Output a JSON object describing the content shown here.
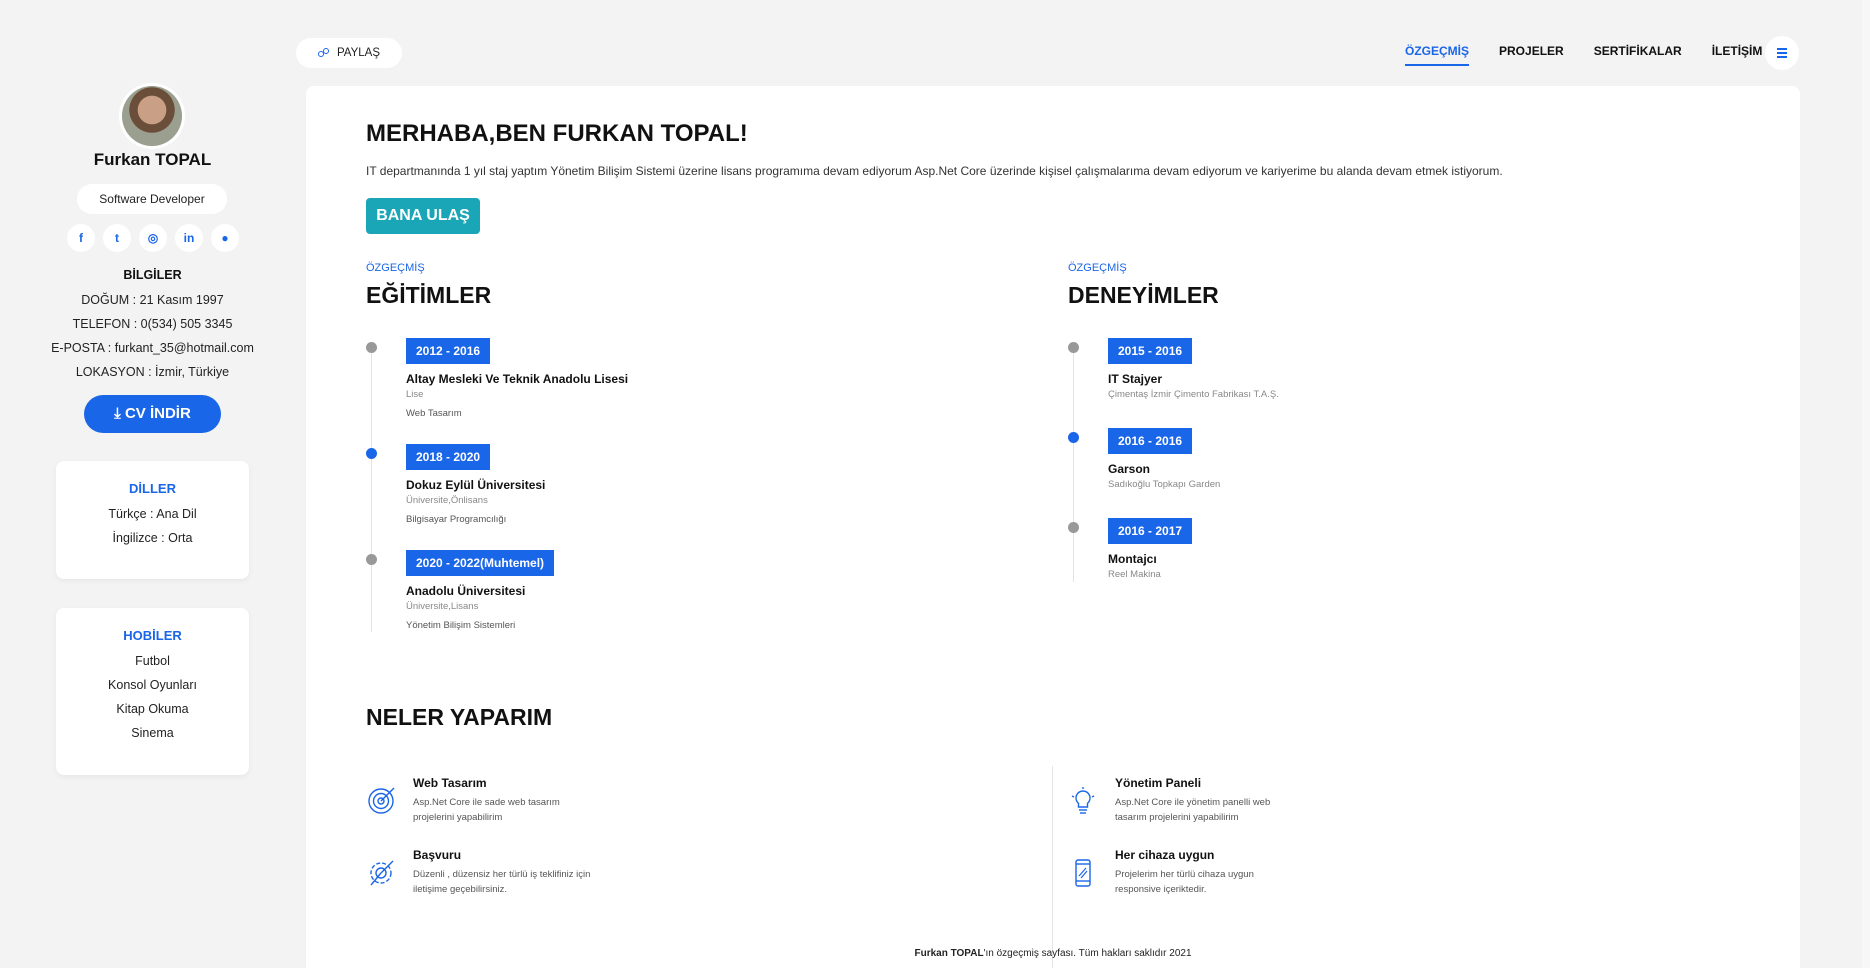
{
  "profile": {
    "name": "Furkan TOPAL",
    "role": "Software Developer",
    "socials": [
      {
        "icon": "facebook-icon",
        "glyph": "f"
      },
      {
        "icon": "twitter-icon",
        "glyph": "t"
      },
      {
        "icon": "instagram-icon",
        "glyph": "◎"
      },
      {
        "icon": "linkedin-icon",
        "glyph": "in"
      },
      {
        "icon": "github-icon",
        "glyph": "●"
      }
    ],
    "info_heading": "BİLGİLER",
    "birth": "DOĞUM : 21 Kasım 1997",
    "phone": "TELEFON : 0(534) 505 3345",
    "email": "E-POSTA : furkant_35@hotmail.com",
    "location": "LOKASYON : İzmir, Türkiye",
    "cv_button": "⤓ CV İNDİR"
  },
  "languages": {
    "title": "DİLLER",
    "items": [
      "Türkçe : Ana Dil",
      "İngilizce : Orta"
    ]
  },
  "hobbies": {
    "title": "HOBİLER",
    "items": [
      "Futbol",
      "Konsol Oyunları",
      "Kitap Okuma",
      "Sinema"
    ]
  },
  "topbar": {
    "share_label": "PAYLAŞ",
    "nav": [
      "ÖZGEÇMİŞ",
      "PROJELER",
      "SERTİFİKALAR",
      "İLETİŞİM"
    ],
    "active_nav": "ÖZGEÇMİŞ"
  },
  "hero": {
    "greeting": "MERHABA,BEN FURKAN TOPAL!",
    "intro": "IT departmanında 1 yıl staj yaptım Yönetim Bilişim Sistemi üzerine lisans programıma devam ediyorum Asp.Net Core üzerinde kişisel çalışmalarıma devam ediyorum ve kariyerime bu alanda devam etmek istiyorum.",
    "contact_button": "BANA ULAŞ"
  },
  "education": {
    "kicker": "ÖZGEÇMİŞ",
    "title": "EĞİTİMLER",
    "items": [
      {
        "years": "2012 - 2016",
        "school": "Altay Mesleki Ve Teknik Anadolu Lisesi",
        "type": "Lise",
        "field": "Web Tasarım",
        "active": false
      },
      {
        "years": "2018 - 2020",
        "school": "Dokuz Eylül Üniversitesi",
        "type": "Üniversite,Önlisans",
        "field": "Bilgisayar Programcılığı",
        "active": true
      },
      {
        "years": "2020 - 2022(Muhtemel)",
        "school": "Anadolu Üniversitesi",
        "type": "Üniversite,Lisans",
        "field": "Yönetim Bilişim Sistemleri",
        "active": false
      }
    ]
  },
  "experience": {
    "kicker": "ÖZGEÇMİŞ",
    "title": "DENEYİMLER",
    "items": [
      {
        "years": "2015 - 2016",
        "role": "IT Stajyer",
        "company": "Çimentaş İzmir Çimento Fabrikası T.A.Ş.",
        "active": false
      },
      {
        "years": "2016 - 2016",
        "role": "Garson",
        "company": "Sadıkoğlu Topkapı Garden",
        "active": true
      },
      {
        "years": "2016 - 2017",
        "role": "Montajcı",
        "company": "Reel Makina",
        "active": false
      }
    ]
  },
  "services": {
    "title": "NELER YAPARIM",
    "items": [
      {
        "icon": "target-icon",
        "title": "Web Tasarım",
        "desc": "Asp.Net Core ile sade web tasarım projelerini yapabilirim"
      },
      {
        "icon": "lightbulb-icon",
        "title": "Yönetim Paneli",
        "desc": "Asp.Net Core ile yönetim panelli web tasarım projelerini yapabilirim"
      },
      {
        "icon": "compass-gear-icon",
        "title": "Başvuru",
        "desc": "Düzenli , düzensiz her türlü iş teklifiniz için iletişime geçebilirsiniz."
      },
      {
        "icon": "mobile-phone-icon",
        "title": "Her cihaza uygun",
        "desc": "Projelerim her türlü cihaza uygun responsive içeriktedir."
      }
    ]
  },
  "footer": {
    "name": "Furkan TOPAL",
    "text": "'ın özgeçmiş sayfası. Tüm hakları saklıdır 2021"
  },
  "colors": {
    "accent": "#1a66e8",
    "teal": "#1aa6b7",
    "background": "#f3f3f3"
  }
}
